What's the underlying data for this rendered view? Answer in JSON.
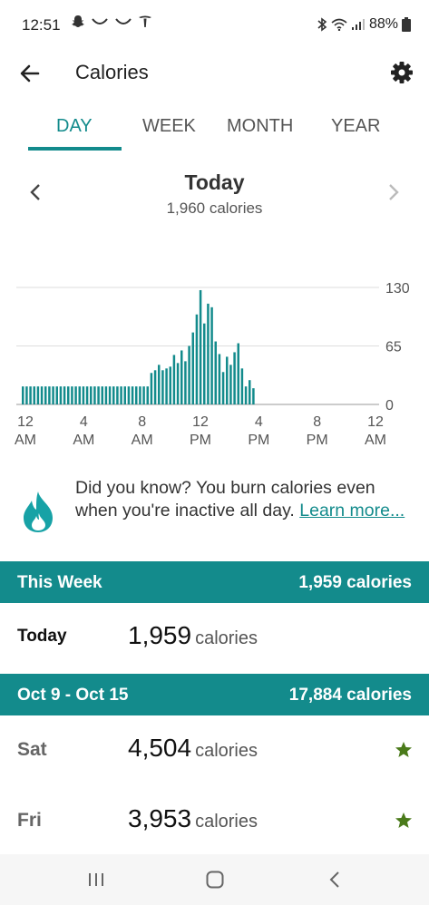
{
  "status": {
    "time": "12:51",
    "battery": "88%"
  },
  "app": {
    "title": "Calories"
  },
  "tabs": [
    {
      "label": "DAY",
      "active": true
    },
    {
      "label": "WEEK",
      "active": false
    },
    {
      "label": "MONTH",
      "active": false
    },
    {
      "label": "YEAR",
      "active": false
    }
  ],
  "date_nav": {
    "title": "Today",
    "subtitle": "1,960 calories"
  },
  "chart_data": {
    "type": "bar",
    "color": "#138b8c",
    "ylim": [
      0,
      130
    ],
    "y_ticks": [
      "130",
      "65",
      "0"
    ],
    "x_ticks": [
      [
        "12",
        "AM"
      ],
      [
        "4",
        "AM"
      ],
      [
        "8",
        "AM"
      ],
      [
        "12",
        "PM"
      ],
      [
        "4",
        "PM"
      ],
      [
        "8",
        "PM"
      ],
      [
        "12",
        "AM"
      ]
    ],
    "values": [
      20,
      20,
      20,
      20,
      20,
      20,
      20,
      20,
      20,
      20,
      20,
      20,
      20,
      20,
      20,
      20,
      20,
      20,
      20,
      20,
      20,
      20,
      20,
      20,
      20,
      20,
      20,
      20,
      20,
      20,
      20,
      20,
      20,
      20,
      35,
      38,
      44,
      38,
      40,
      42,
      55,
      46,
      60,
      48,
      65,
      80,
      100,
      127,
      90,
      112,
      108,
      70,
      56,
      36,
      53,
      44,
      58,
      68,
      40,
      20,
      27,
      18
    ]
  },
  "tip": {
    "text": "Did you know? You burn calories even when you're inactive all day. ",
    "link": "Learn more..."
  },
  "this_week": {
    "label": "This Week",
    "total": "1,959 calories",
    "rows": [
      {
        "day": "Today",
        "value": "1,959",
        "unit": "calories",
        "star": false
      }
    ]
  },
  "prev_week": {
    "label": "Oct 9 - Oct 15",
    "total": "17,884 calories",
    "rows": [
      {
        "day": "Sat",
        "value": "4,504",
        "unit": "calories",
        "star": true
      },
      {
        "day": "Fri",
        "value": "3,953",
        "unit": "calories",
        "star": true
      }
    ]
  },
  "colors": {
    "accent": "#138b8c",
    "star": "#4a7a1a"
  }
}
